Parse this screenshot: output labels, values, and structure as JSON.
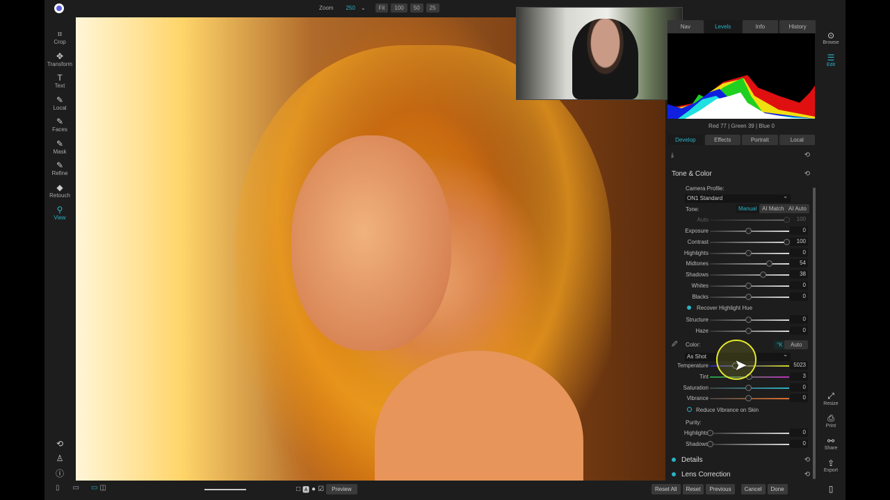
{
  "topbar": {
    "zoom_label": "Zoom",
    "zoom_value": "250",
    "zoom_presets": [
      "Fit",
      "100",
      "50",
      "25"
    ]
  },
  "left_tools": [
    {
      "label": "Crop",
      "icon": "crop-icon"
    },
    {
      "label": "Transform",
      "icon": "move-icon"
    },
    {
      "label": "Text",
      "icon": "text-icon"
    },
    {
      "label": "Local",
      "icon": "brush-icon"
    },
    {
      "label": "Faces",
      "icon": "faces-icon"
    },
    {
      "label": "Mask",
      "icon": "mask-icon"
    },
    {
      "label": "Refine",
      "icon": "refine-icon"
    },
    {
      "label": "Retouch",
      "icon": "retouch-icon"
    },
    {
      "label": "View",
      "icon": "view-icon",
      "active": true
    }
  ],
  "panel": {
    "tabs": [
      "Nav",
      "Levels",
      "Info",
      "History"
    ],
    "active_tab": "Levels",
    "rgb_readout": "Red  77  | Green  39  | Blue  0",
    "develop_tabs": [
      "Develop",
      "Effects",
      "Portrait",
      "Local"
    ],
    "section_title": "Tone & Color",
    "camera_profile_label": "Camera Profile:",
    "camera_profile": "ON1 Standard",
    "tone_label": "Tone:",
    "tone_modes": [
      "Manual",
      "AI Match",
      "AI Auto"
    ],
    "auto": {
      "label": "Auto",
      "value": "100"
    },
    "tone_sliders": [
      {
        "label": "Exposure",
        "value": "0",
        "pos": 0.5
      },
      {
        "label": "Contrast",
        "value": "100",
        "pos": 1.0
      },
      {
        "label": "Highlights",
        "value": "0",
        "pos": 0.5
      },
      {
        "label": "Midtones",
        "value": "54",
        "pos": 0.77
      },
      {
        "label": "Shadows",
        "value": "38",
        "pos": 0.69
      },
      {
        "label": "Whites",
        "value": "0",
        "pos": 0.5
      },
      {
        "label": "Blacks",
        "value": "0",
        "pos": 0.5
      }
    ],
    "recover_highlight": "Recover Highlight Hue",
    "presence_sliders": [
      {
        "label": "Structure",
        "value": "0",
        "pos": 0.5
      },
      {
        "label": "Haze",
        "value": "0",
        "pos": 0.5
      }
    ],
    "color_label": "Color:",
    "kelvin_btn": "°K",
    "auto_btn": "Auto",
    "wb": "As Shot",
    "color_sliders": [
      {
        "label": "Temperature",
        "value": "5023",
        "pos": 0.33
      },
      {
        "label": "Tint",
        "value": "3",
        "pos": 0.51
      },
      {
        "label": "Saturation",
        "value": "0",
        "pos": 0.5
      },
      {
        "label": "Vibrance",
        "value": "0",
        "pos": 0.5
      }
    ],
    "reduce_vibrance": "Reduce Vibrance on Skin",
    "purity_label": "Purity:",
    "purity_sliders": [
      {
        "label": "Highlights",
        "value": "0",
        "pos": 0
      },
      {
        "label": "Shadows",
        "value": "0",
        "pos": 0
      }
    ],
    "details": "Details",
    "lens": "Lens Correction"
  },
  "right_bar": [
    {
      "label": "Browse",
      "icon": "browse-icon"
    },
    {
      "label": "Edit",
      "icon": "edit-icon",
      "active": true
    },
    {
      "label": "Resize",
      "icon": "resize-icon"
    },
    {
      "label": "Print",
      "icon": "print-icon"
    },
    {
      "label": "Share",
      "icon": "share-icon"
    },
    {
      "label": "Export",
      "icon": "export-icon"
    }
  ],
  "bottom": {
    "preview": "Preview",
    "actions": [
      "Reset All",
      "Reset",
      "Previous",
      "Cancel",
      "Done"
    ]
  },
  "colors": {
    "accent": "#2bb3c6",
    "cursor_highlight": "#e7ea2c"
  }
}
